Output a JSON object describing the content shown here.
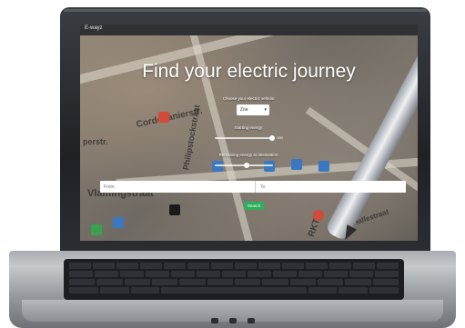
{
  "app": {
    "brand": "E-wayz"
  },
  "hero": {
    "title": "Find your electric journey"
  },
  "vehicle": {
    "label": "Choose your electric vehicle:",
    "selected": "Zoe"
  },
  "starting_energy": {
    "label": "Starting energy:",
    "value_text": "100",
    "level_fraction": 0.98
  },
  "remaining_energy": {
    "label": "Remaining energy at destination:",
    "level_fraction": 0.55
  },
  "route": {
    "from_placeholder": "From",
    "to_placeholder": "To"
  },
  "search": {
    "button_label": "Search"
  },
  "map_labels": {
    "street_1": "Vlamingstraat",
    "street_2": "Cordoeanierstr.",
    "street_3": "Philipstockstraat",
    "street_4": "Hallestraat",
    "street_5": "perstr.",
    "street_6": "RKT"
  },
  "colors": {
    "topbar": "#2f3135",
    "search_button": "#2eaf5c",
    "title_text": "#ffffff"
  },
  "icons": [
    "pen-stylus-icon",
    "chevron-down-icon",
    "laptop-frame-icon"
  ]
}
